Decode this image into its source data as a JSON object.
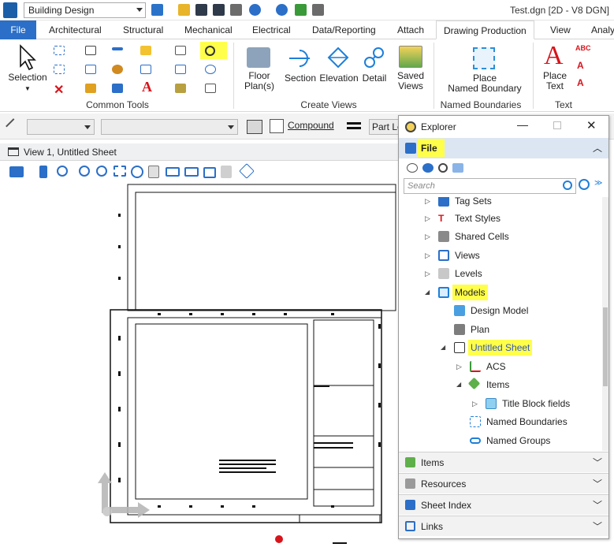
{
  "qat": {
    "workflow": "Building Design",
    "doc_title": "Test.dgn [2D - V8 DGN]"
  },
  "tabs": [
    {
      "label": "File"
    },
    {
      "label": "Architectural"
    },
    {
      "label": "Structural"
    },
    {
      "label": "Mechanical"
    },
    {
      "label": "Electrical"
    },
    {
      "label": "Data/Reporting"
    },
    {
      "label": "Attach"
    },
    {
      "label": "Drawing Production"
    },
    {
      "label": "View"
    },
    {
      "label": "Analy"
    }
  ],
  "ribbon": {
    "selection": "Selection",
    "common_tools": "Common Tools",
    "floor_plans": "Floor\nPlan(s)",
    "floor": "Floor",
    "plans": "Plan(s)",
    "section": "Section",
    "elevation": "Elevation",
    "detail": "Detail",
    "saved": "Saved",
    "views": "Views",
    "create_views": "Create Views",
    "place": "Place",
    "named_boundary": "Named Boundary",
    "named_boundaries": "Named Boundaries",
    "place_text_1": "Place",
    "place_text_2": "Text",
    "text_group": "Text"
  },
  "toolbar2": {
    "compound": "Compound",
    "part_level": "Part Le"
  },
  "view": {
    "title": "View 1, Untitled Sheet"
  },
  "explorer": {
    "title": "Explorer",
    "file_label": "File",
    "search_placeholder": "Search",
    "tree": [
      {
        "label": "Tag Sets"
      },
      {
        "label": "Text Styles"
      },
      {
        "label": "Shared Cells"
      },
      {
        "label": "Views"
      },
      {
        "label": "Levels"
      },
      {
        "label": "Models"
      },
      {
        "label": "Design Model"
      },
      {
        "label": "Plan"
      },
      {
        "label": "Untitled Sheet"
      },
      {
        "label": "ACS"
      },
      {
        "label": "Items"
      },
      {
        "label": "Title Block fields"
      },
      {
        "label": "Named Boundaries"
      },
      {
        "label": "Named Groups"
      }
    ],
    "panels": [
      {
        "label": "Items"
      },
      {
        "label": "Resources"
      },
      {
        "label": "Sheet Index"
      },
      {
        "label": "Links"
      }
    ]
  },
  "colors": {
    "file_tab": "#2b6fc8",
    "highlight": "#ffff4a",
    "accent_blue": "#1e7fd8",
    "red": "#d8141b"
  }
}
